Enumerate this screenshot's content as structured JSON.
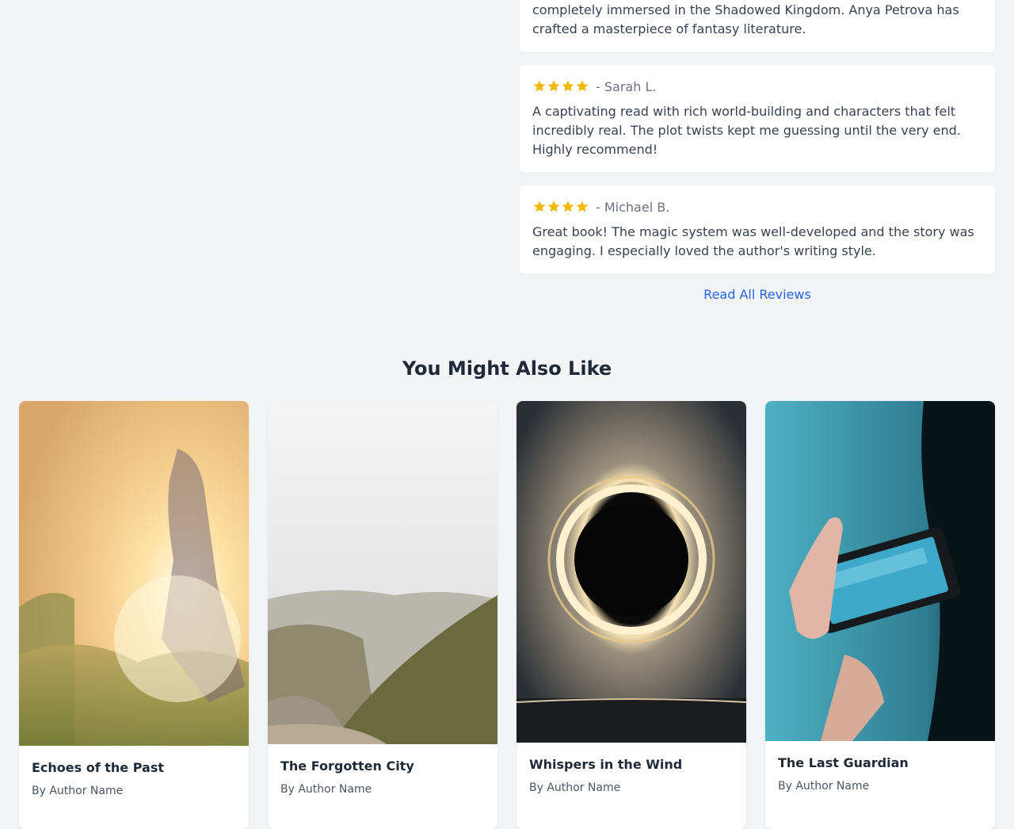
{
  "reviews": {
    "first_text": "completely immersed in the Shadowed Kingdom. Anya Petrova has crafted a masterpiece of fantasy literature.",
    "items": [
      {
        "reviewer": "- Sarah L.",
        "rating": 4,
        "text": "A captivating read with rich world-building and characters that felt incredibly real. The plot twists kept me guessing until the very end. Highly recommend!"
      },
      {
        "reviewer": "- Michael B.",
        "rating": 4,
        "text": "Great book! The magic system was well-developed and the story was engaging. I especially loved the author's writing style."
      }
    ],
    "read_all_label": "Read All Reviews"
  },
  "recommendations": {
    "title": "You Might Also Like",
    "books": [
      {
        "title": "Echoes of the Past",
        "author": "By Author Name",
        "cover": "sunlit-field-photo"
      },
      {
        "title": "The Forgotten City",
        "author": "By Author Name",
        "cover": "misty-mountain-path-photo"
      },
      {
        "title": "Whispers in the Wind",
        "author": "By Author Name",
        "cover": "steel-wool-light-ring-photo"
      },
      {
        "title": "The Last Guardian",
        "author": "By Author Name",
        "cover": "phone-city-view-photo"
      }
    ]
  },
  "colors": {
    "star": "#f2b707",
    "link": "#2563eb",
    "background": "#f3f4f6"
  }
}
